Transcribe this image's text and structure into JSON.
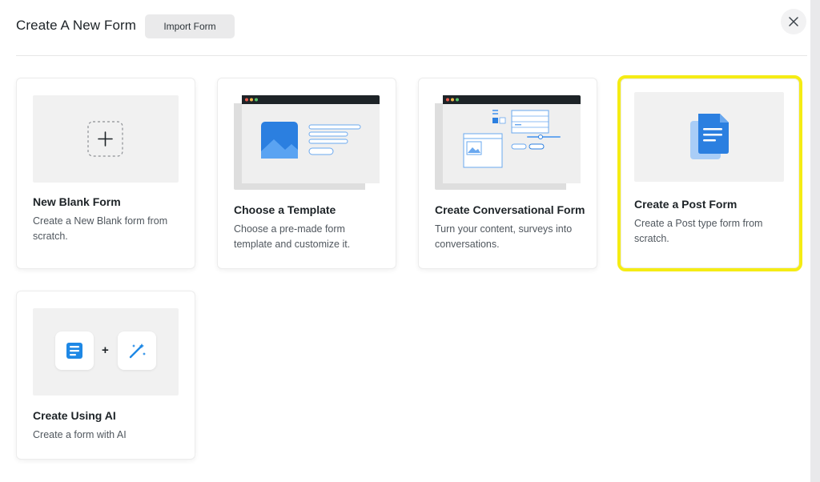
{
  "header": {
    "title": "Create A New Form",
    "import_label": "Import Form",
    "close_icon": "close-icon"
  },
  "cards": [
    {
      "title": "New Blank Form",
      "description": "Create a New Blank form from scratch.",
      "icon": "plus-icon"
    },
    {
      "title": "Choose a Template",
      "description": "Choose a pre-made form template and customize it.",
      "icon": "template-illustration"
    },
    {
      "title": "Create Conversational Form",
      "description": "Turn your content, surveys into conversations.",
      "icon": "conversational-illustration"
    },
    {
      "title": "Create a Post Form",
      "description": "Create a Post type form from scratch.",
      "icon": "document-icon",
      "highlighted": true
    },
    {
      "title": "Create Using AI",
      "description": "Create a form with AI",
      "icon": "ai-magic-wand-icon"
    }
  ],
  "ai_plus_symbol": "+",
  "colors": {
    "accent": "#2b7fe0",
    "highlight": "#f5ec14",
    "thumb_bg": "#f1f1f1"
  }
}
